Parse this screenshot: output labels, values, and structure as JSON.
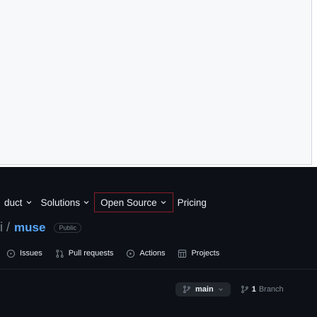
{
  "nav": {
    "product": "duct",
    "solutions": "Solutions",
    "open_source": "Open Source",
    "pricing": "Pricing"
  },
  "repo": {
    "slash": "i /",
    "name": "muse",
    "visibility": "Public"
  },
  "tabs": [
    {
      "label": "Issues",
      "icon": "issue-icon"
    },
    {
      "label": "Pull requests",
      "icon": "pull-request-icon"
    },
    {
      "label": "Actions",
      "icon": "actions-icon"
    },
    {
      "label": "Projects",
      "icon": "projects-icon"
    }
  ],
  "branch": {
    "name": "main",
    "count": "1",
    "label": "Branch"
  },
  "colors": {
    "background": "#0d1117",
    "link": "#58a6ff",
    "highlight_border": "#8b1d2a"
  }
}
